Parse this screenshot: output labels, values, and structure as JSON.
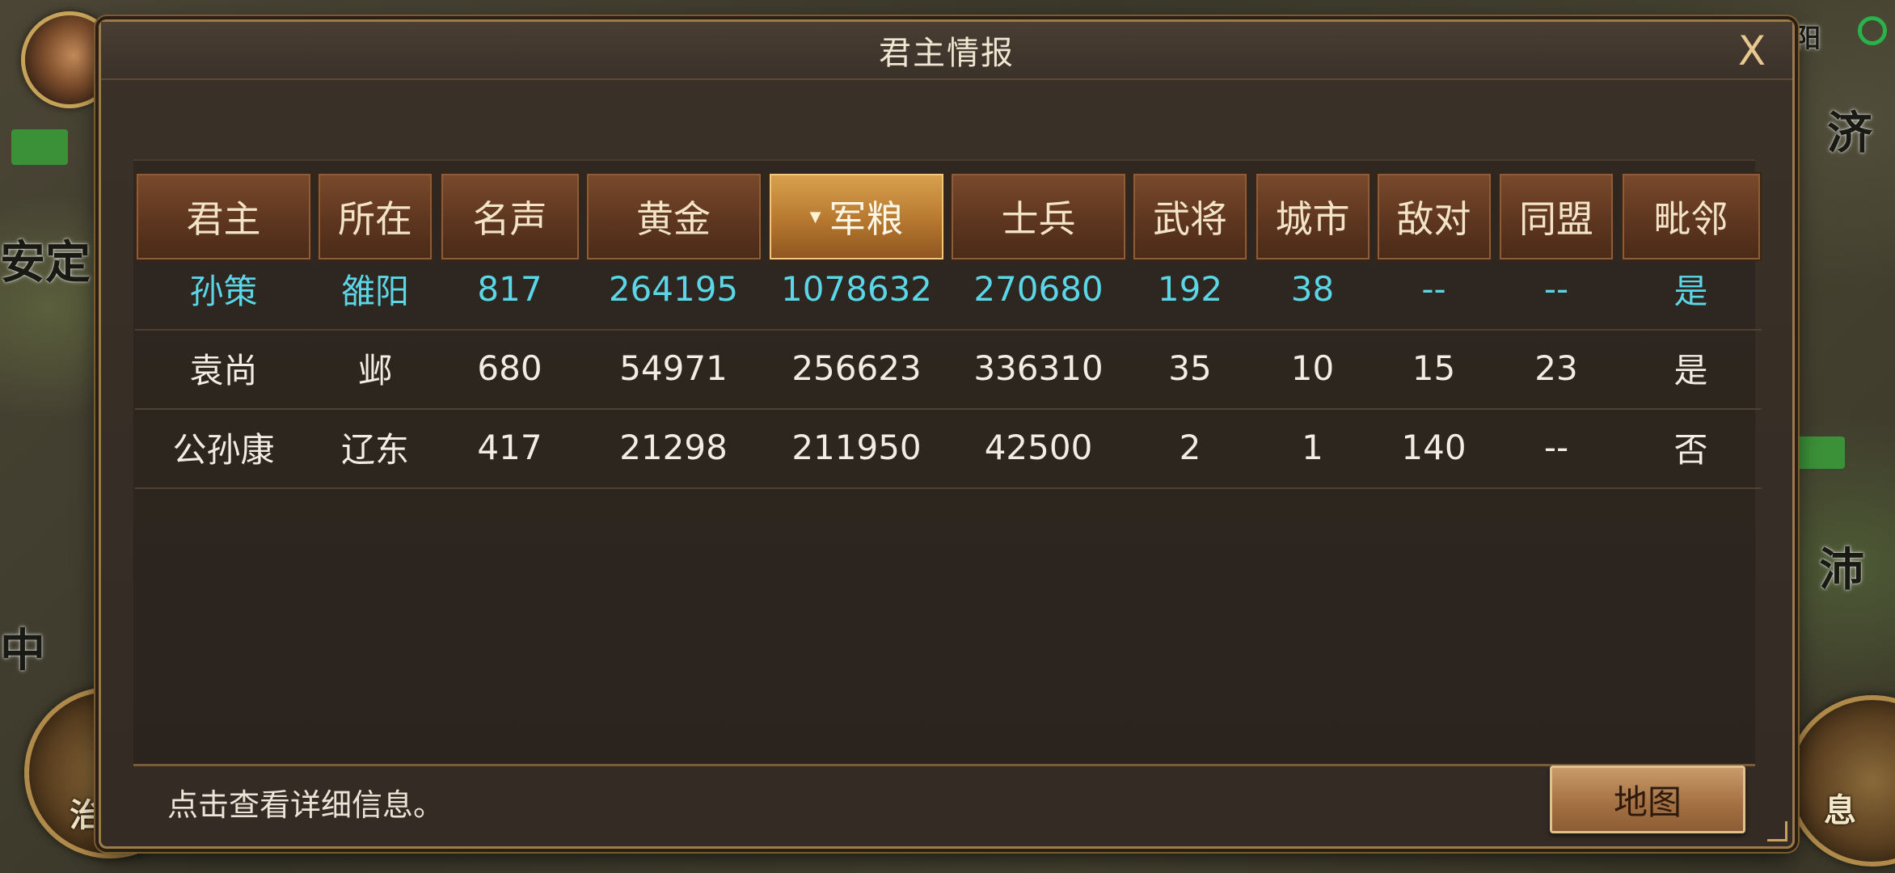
{
  "dialog": {
    "title": "君主情报",
    "close_label": "X",
    "footer_hint": "点击查看详细信息。",
    "map_button": "地图"
  },
  "table": {
    "headers": [
      "君主",
      "所在",
      "名声",
      "黄金",
      "军粮",
      "士兵",
      "武将",
      "城市",
      "敌对",
      "同盟",
      "毗邻"
    ],
    "sorted_column": "军粮",
    "sort_indicator": "▼",
    "rows": [
      [
        "孙策",
        "雒阳",
        "817",
        "264195",
        "1078632",
        "270680",
        "192",
        "38",
        "--",
        "--",
        "是"
      ],
      [
        "袁尚",
        "邺",
        "680",
        "54971",
        "256623",
        "336310",
        "35",
        "10",
        "15",
        "23",
        "是"
      ],
      [
        "公孙康",
        "辽东",
        "417",
        "21298",
        "211950",
        "42500",
        "2",
        "1",
        "140",
        "--",
        "否"
      ]
    ],
    "highlight_color": "#5bd6e6"
  },
  "map_labels": {
    "left_top": "安定",
    "left_mid": "中",
    "left_bottom": "治",
    "right_top": "阳",
    "right_upper": "济",
    "right_mid": "沛",
    "right_bottom": "息"
  }
}
